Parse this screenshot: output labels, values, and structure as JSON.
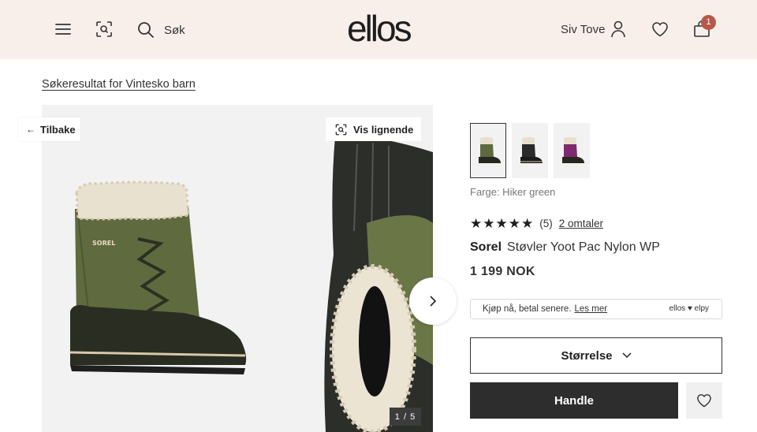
{
  "header": {
    "search_label": "Søk",
    "logo_text": "ellos",
    "user_name": "Siv Tove",
    "cart_count": "1"
  },
  "breadcrumb": "Søkeresultat for Vintesko barn",
  "gallery": {
    "back_label": "Tilbake",
    "similar_label": "Vis lignende",
    "counter": "1 / 5"
  },
  "product": {
    "swatches": [
      {
        "name": "Hiker green",
        "color": "#5d6a3f",
        "selected": true
      },
      {
        "name": "black",
        "color": "#2a2a2a",
        "selected": false
      },
      {
        "name": "purple",
        "color": "#7e2a6e",
        "selected": false
      }
    ],
    "color_line": "Farge: Hiker green",
    "rating_value": 5,
    "rating_count": "(5)",
    "reviews_link": "2 omtaler",
    "brand": "Sorel",
    "name": "Støvler Yoot Pac Nylon WP",
    "price": "1 199 NOK"
  },
  "paylater": {
    "text": "Kjøp nå, betal senere.",
    "link": "Les mer",
    "partner": "ellos ♥ elpy"
  },
  "actions": {
    "size_label": "Størrelse",
    "buy_label": "Handle"
  }
}
